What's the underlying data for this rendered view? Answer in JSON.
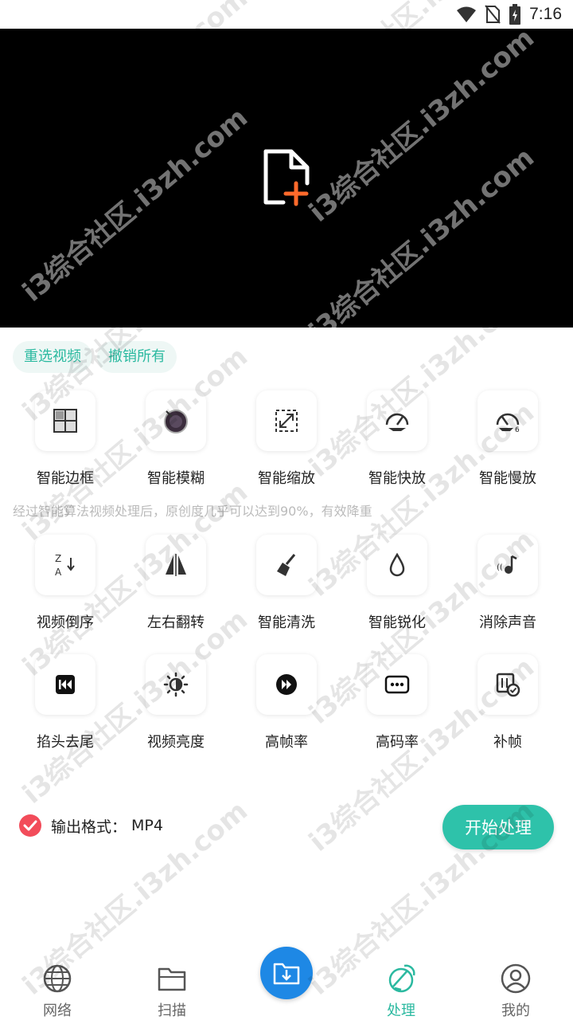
{
  "status_bar": {
    "time": "7:16"
  },
  "chips": {
    "reselect": "重选视频",
    "undo_all": "撤销所有"
  },
  "tools_row1": [
    "智能边框",
    "智能模糊",
    "智能缩放",
    "智能快放",
    "智能慢放"
  ],
  "description": "经过智能算法视频处理后，原创度几乎可以达到90%，有效降重",
  "tools_row2": [
    "视频倒序",
    "左右翻转",
    "智能清洗",
    "智能锐化",
    "消除声音"
  ],
  "tools_row3": [
    "掐头去尾",
    "视频亮度",
    "高帧率",
    "高码率",
    "补帧"
  ],
  "format": {
    "label": "输出格式：",
    "value": "MP4"
  },
  "start_button": "开始处理",
  "nav": {
    "network": "网络",
    "scan": "扫描",
    "process": "处理",
    "mine": "我的"
  },
  "watermark": "i3综合社区.i3zh.com",
  "colors": {
    "accent": "#2ec2aa",
    "fab": "#1e88e5",
    "check": "#f24c5a",
    "plus": "#ff6a2b"
  }
}
